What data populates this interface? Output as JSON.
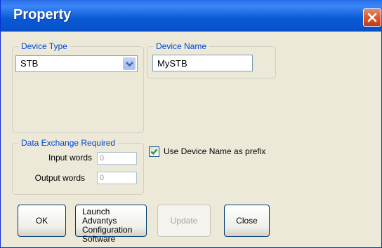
{
  "window": {
    "title": "Property",
    "close_icon": "close-x-icon"
  },
  "device_type": {
    "legend": "Device Type",
    "selected": "STB",
    "arrow_icon": "chevron-down-icon"
  },
  "device_name": {
    "legend": "Device Name",
    "value": "MySTB"
  },
  "data_exchange": {
    "legend": "Data Exchange Required",
    "input_label": "Input words",
    "input_value": "0",
    "output_label": "Output words",
    "output_value": "0"
  },
  "prefix_checkbox": {
    "label": "Use Device Name as prefix",
    "checked": true
  },
  "buttons": {
    "ok": "OK",
    "launch_line1": "Launch Advantys",
    "launch_line2": "Configuration",
    "launch_line3": "Software",
    "update": "Update",
    "close": "Close"
  },
  "colors": {
    "title_bar": "#0a5ad5",
    "legend_text": "#0046d5",
    "close_button": "#d9532c",
    "background": "#ece9d8"
  }
}
